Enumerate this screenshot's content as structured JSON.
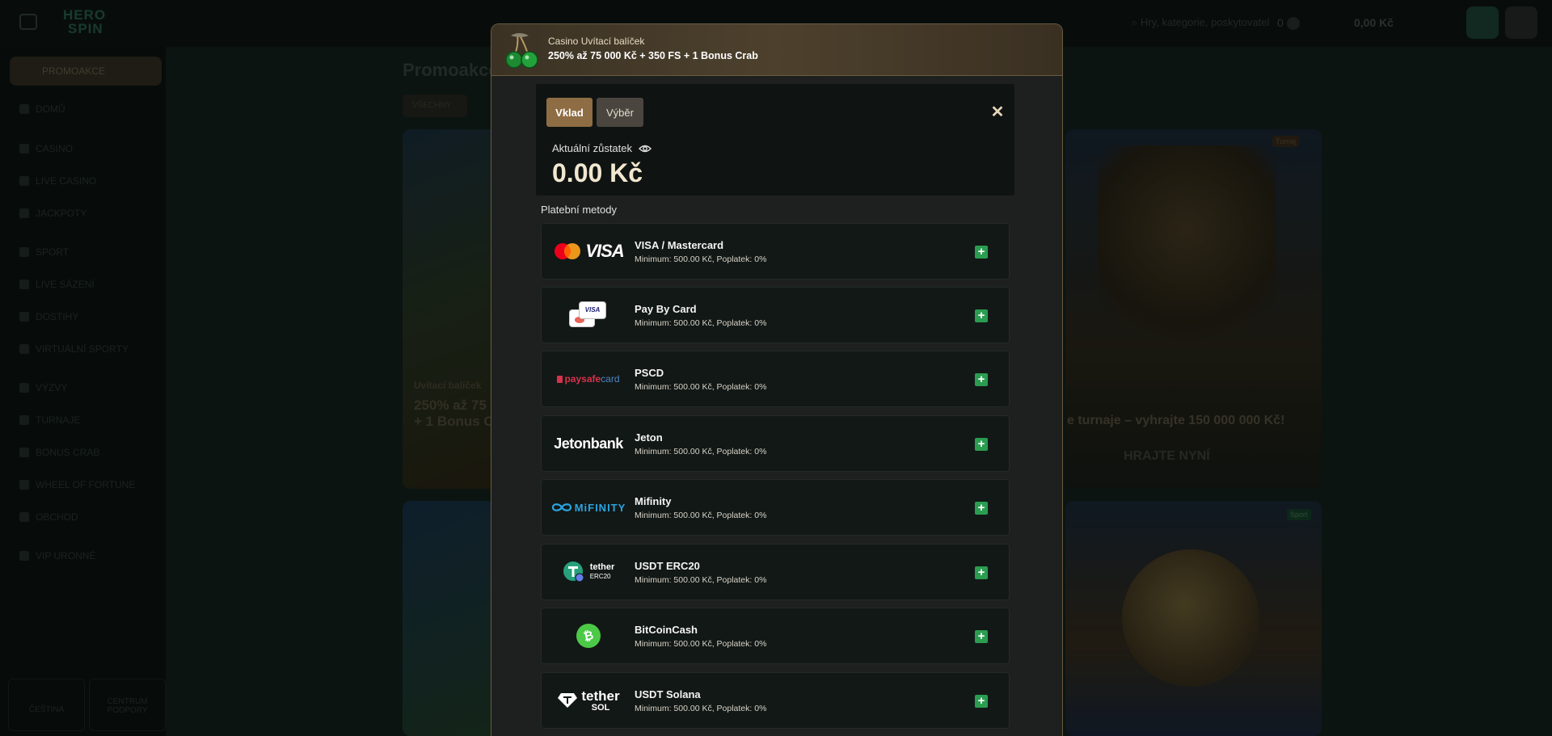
{
  "brand": {
    "line1": "HERO",
    "line2": "SPIN"
  },
  "sidebar": {
    "active": "PROMOAKCE",
    "items": [
      "DOMŮ",
      "CASINO",
      "LIVE CASINO",
      "JACKPOTY",
      "SPORT",
      "LIVE SÁZENÍ",
      "DOSTIHY",
      "VIRTUÁLNÍ SPORTY",
      "VÝZVY",
      "TURNAJE",
      "BONUS CRAB",
      "WHEEL OF FORTUNE",
      "OBCHOD",
      "VIP URONNÉ"
    ],
    "footer": {
      "lang": "ČEŠTINA",
      "support_line1": "CENTRUM",
      "support_line2": "PODPORY"
    }
  },
  "header": {
    "search_placeholder": "Hry, kategorie, poskytovatel",
    "count": "0",
    "balance": "0,00 Kč"
  },
  "page": {
    "title": "Promoakce",
    "filter": "VŠECHNY",
    "card_left": {
      "sub": "Uvítací balíček",
      "title_line1": "250% až 75",
      "title_line2": "+ 1 Bonus C"
    },
    "card_right": {
      "text": "e turnaje – vyhrajte 150 000 000 Kč!",
      "cta": "HRAJTE NYNÍ"
    },
    "badge_top": "Turnaj",
    "badge_bottom": "Sport"
  },
  "modal": {
    "promo": {
      "subtitle": "Casino Uvítací balíček",
      "title": "250% až 75 000 Kč + 350 FS + 1 Bonus Crab"
    },
    "tabs": {
      "deposit": "Vklad",
      "withdraw": "Výběr"
    },
    "balance_label": "Aktuální zůstatek",
    "balance_value": "0.00 Kč",
    "methods_label": "Platební metody",
    "methods": [
      {
        "name": "VISA / Mastercard",
        "info": "Minimum: 500.00 Kč, Poplatek: 0%",
        "logo": "visa-mastercard"
      },
      {
        "name": "Pay By Card",
        "info": "Minimum: 500.00 Kč, Poplatek: 0%",
        "logo": "pay-by-card"
      },
      {
        "name": "PSCD",
        "info": "Minimum: 500.00 Kč, Poplatek: 0%",
        "logo": "paysafecard"
      },
      {
        "name": "Jeton",
        "info": "Minimum: 500.00 Kč, Poplatek: 0%",
        "logo": "jetonbank"
      },
      {
        "name": "Mifinity",
        "info": "Minimum: 500.00 Kč, Poplatek: 0%",
        "logo": "mifinity"
      },
      {
        "name": "USDT ERC20",
        "info": "Minimum: 500.00 Kč, Poplatek: 0%",
        "logo": "tether-erc20"
      },
      {
        "name": "BitCoinCash",
        "info": "Minimum: 500.00 Kč, Poplatek: 0%",
        "logo": "bitcoincash"
      },
      {
        "name": "USDT Solana",
        "info": "Minimum: 500.00 Kč, Poplatek: 0%",
        "logo": "tether-sol"
      }
    ],
    "logo_text": {
      "visa": "VISA",
      "card_visa": "VISA",
      "paysafe_a": "paysafe",
      "paysafe_b": "card",
      "jetonbank": "Jetonbank",
      "mifinity": "MiFINITY",
      "tether": "tether",
      "erc20": "ERC20",
      "sol": "SOL"
    }
  },
  "colors": {
    "accent": "#8e6d44",
    "plus": "#2a9d50",
    "modal_bg": "#1e201f",
    "border": "#6b5a40"
  }
}
